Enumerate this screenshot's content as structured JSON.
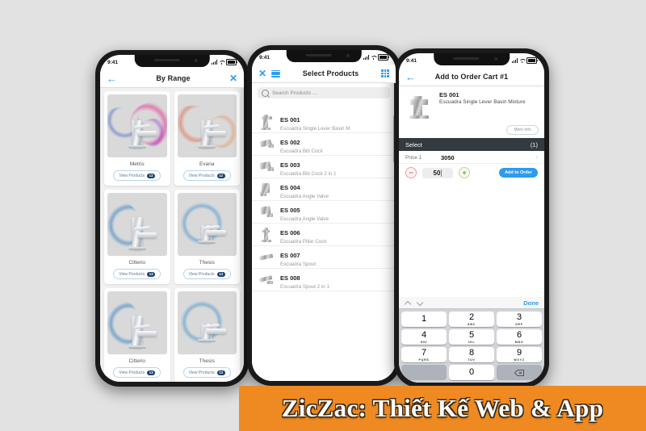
{
  "colors": {
    "accent_blue": "#2e9bed",
    "banner_orange": "#ef8a22",
    "dark_bar": "#333a40",
    "page_background": "#e2e2e2",
    "badge_navy": "#1d3f6e"
  },
  "banner": {
    "text": "ZicZac: Thiết Kế Web & App"
  },
  "phone1": {
    "status": {
      "time": "9:41"
    },
    "nav": {
      "back_icon": "back-arrow-icon",
      "title": "By Range",
      "close_icon": "close-icon"
    },
    "ranges": [
      {
        "name": "Metris",
        "button_label": "View Products",
        "count": "12"
      },
      {
        "name": "Evana",
        "button_label": "View Products",
        "count": "12"
      },
      {
        "name": "Citterio",
        "button_label": "View Products",
        "count": "13"
      },
      {
        "name": "Thesis",
        "button_label": "View Products",
        "count": "13"
      },
      {
        "name": "Citterio",
        "button_label": "View Products",
        "count": "13"
      },
      {
        "name": "Thesis",
        "button_label": "View Products",
        "count": "13"
      }
    ]
  },
  "phone2": {
    "status": {
      "time": "9:41"
    },
    "nav": {
      "close_icon": "close-icon",
      "list_icon": "list-view-icon",
      "title": "Select Products",
      "grid_icon": "grid-view-icon"
    },
    "search": {
      "placeholder": "Search Products ...",
      "value": ""
    },
    "products": [
      {
        "code": "ES 001",
        "desc": "Escuadra Single Lever Basin M"
      },
      {
        "code": "ES 002",
        "desc": "Escuadra Bib Cock"
      },
      {
        "code": "ES 003",
        "desc": "Escuadra Bib Cock 2 in 1"
      },
      {
        "code": "ES 004",
        "desc": "Escuadra Angle Valve"
      },
      {
        "code": "ES 005",
        "desc": "Escuadra Angle Valve"
      },
      {
        "code": "ES 006",
        "desc": "Escuadra Pillar Cock"
      },
      {
        "code": "ES 007",
        "desc": "Escuadra Spout"
      },
      {
        "code": "ES 008",
        "desc": "Escuadra Spout 2 in 1"
      }
    ]
  },
  "phone3": {
    "status": {
      "time": "9:41"
    },
    "nav": {
      "back_icon": "back-arrow-icon",
      "title": "Add to Order Cart #1"
    },
    "item": {
      "code": "ES 001",
      "desc": "Escuadra Single Lever Basin Mixture",
      "more_info_label": "More Info"
    },
    "select_bar": {
      "label": "Select",
      "count": "(1)"
    },
    "price": {
      "label": "Price 1",
      "value": "3050"
    },
    "quantity": {
      "minus_label": "−",
      "plus_label": "+",
      "value": "50",
      "add_label": "Add to Order"
    },
    "keyboard": {
      "done_label": "Done",
      "keys": [
        {
          "num": "1",
          "sub": ""
        },
        {
          "num": "2",
          "sub": "ABC"
        },
        {
          "num": "3",
          "sub": "DEF"
        },
        {
          "num": "4",
          "sub": "GHI"
        },
        {
          "num": "5",
          "sub": "JKL"
        },
        {
          "num": "6",
          "sub": "MNO"
        },
        {
          "num": "7",
          "sub": "PQRS"
        },
        {
          "num": "8",
          "sub": "TUV"
        },
        {
          "num": "9",
          "sub": "WXYZ"
        }
      ],
      "zero": "0",
      "delete_icon": "backspace-icon"
    }
  }
}
